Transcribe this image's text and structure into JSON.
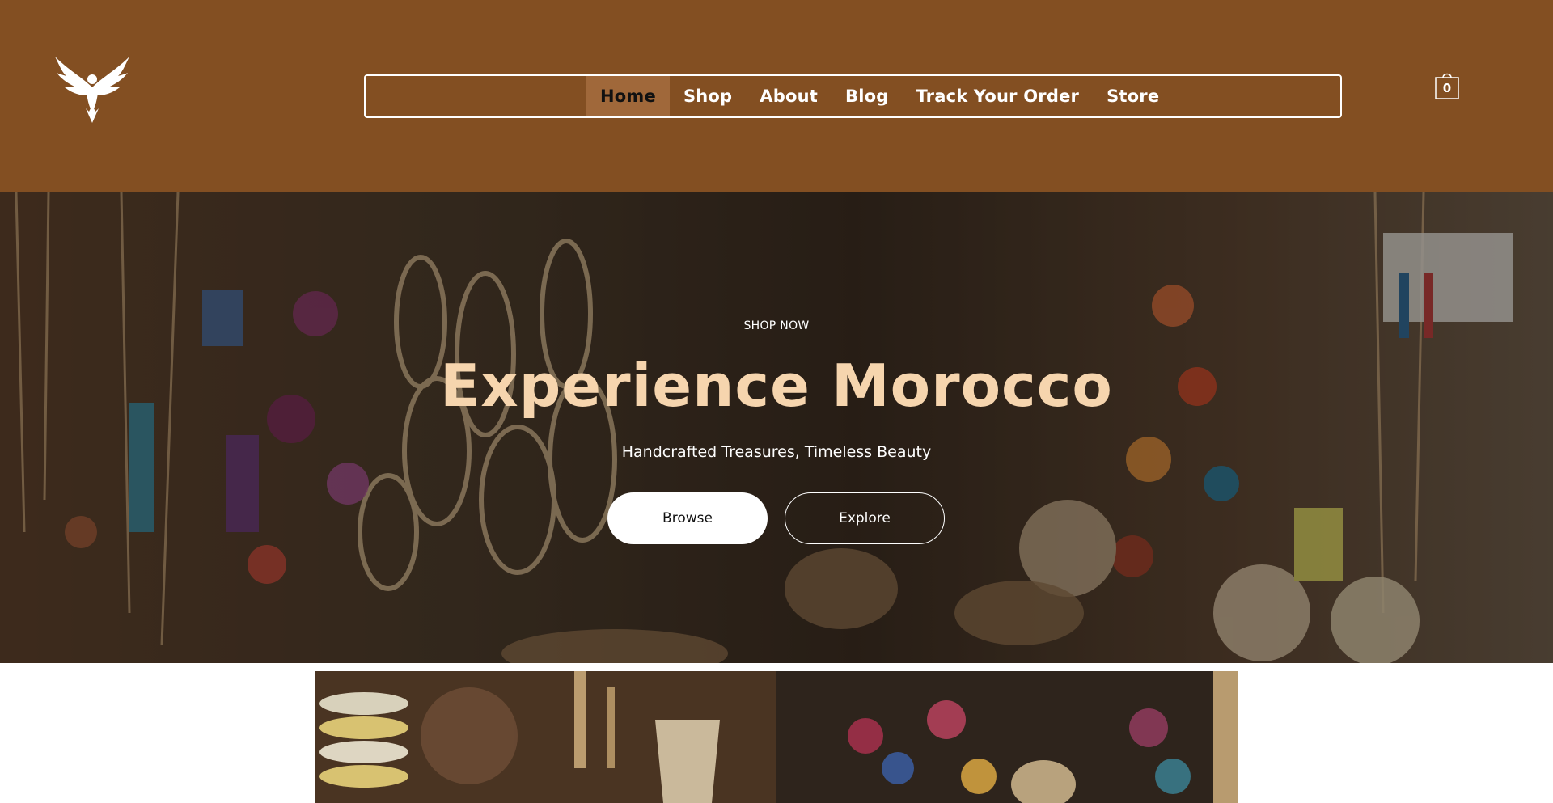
{
  "header": {
    "logo": {
      "icon": "eagle-logo-icon"
    },
    "nav": {
      "items": [
        {
          "label": "Home",
          "active": true
        },
        {
          "label": "Shop",
          "active": false
        },
        {
          "label": "About",
          "active": false
        },
        {
          "label": "Blog",
          "active": false
        },
        {
          "label": "Track Your Order",
          "active": false
        },
        {
          "label": "Store",
          "active": false
        }
      ]
    },
    "cart": {
      "icon": "shopping-bag-icon",
      "count": "0"
    },
    "colors": {
      "background": "#834f22",
      "active_item": "#a0683a"
    }
  },
  "hero": {
    "eyebrow": "SHOP NOW",
    "title": "Experience Morocco",
    "subtitle": "Handcrafted Treasures, Timeless Beauty",
    "buttons": {
      "primary": "Browse",
      "secondary": "Explore"
    },
    "colors": {
      "title": "#f6d5ae"
    }
  }
}
